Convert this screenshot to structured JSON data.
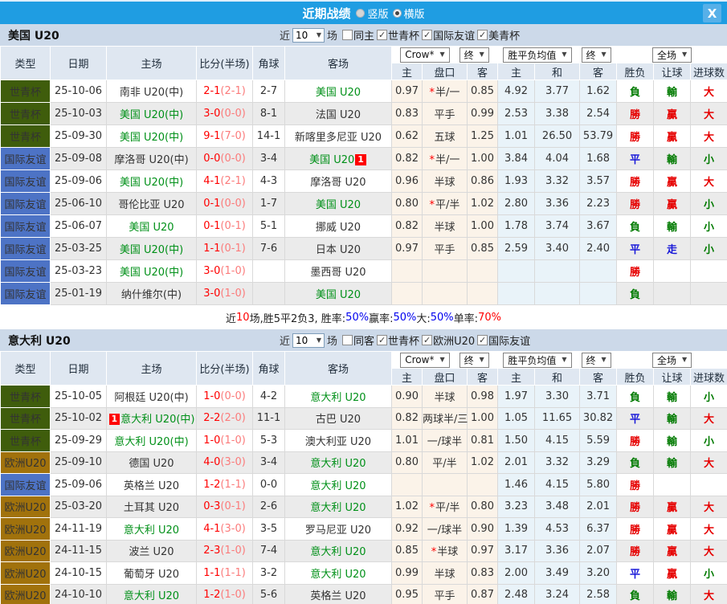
{
  "titlebar": {
    "title": "近期战绩",
    "radios": [
      {
        "label": "竖版",
        "selected": false
      },
      {
        "label": "横版",
        "selected": true
      }
    ],
    "close": "X"
  },
  "glyphs": {
    "check": "✓",
    "arrow": "▼",
    "star": "*"
  },
  "colors": {
    "header_bar": "#1f9de2",
    "section_bar": "#ccd9e9",
    "table_head": "#dfe7f1",
    "row_alt": "#ebebeb",
    "cream": "#fbf3e9",
    "lightblue": "#e9f3f9",
    "team_green": "#009018",
    "score_red": "#ff0000",
    "score_ht": "#fb7b7b"
  },
  "type_styles": {
    "世青杯": "#3f5d0c",
    "国际友谊": "#4d73c5",
    "欧洲U20": "#a1720c"
  },
  "result_colors": {
    "勝": "#e60000",
    "贏": "#e60000",
    "大": "#e60000",
    "負": "#007a00",
    "輸": "#007a00",
    "小": "#007a00",
    "平": "#1818d8",
    "走": "#1818d8"
  },
  "header": {
    "cols": [
      "类型",
      "日期",
      "主场",
      "比分(半场)",
      "角球",
      "客场"
    ],
    "dd1": "Crow*",
    "dd1b": "终",
    "dd2": "胜平负均值",
    "dd2b": "终",
    "dd3": "全场",
    "subcols": [
      "主",
      "盘口",
      "客",
      "主",
      "和",
      "客",
      "胜负",
      "让球",
      "进球数"
    ]
  },
  "sections": [
    {
      "team": "美国 U20",
      "filter": {
        "near": "近",
        "count": "10",
        "unit": "场",
        "checks": [
          {
            "label": "同主",
            "checked": false
          },
          {
            "label": "世青杯",
            "checked": true
          },
          {
            "label": "国际友谊",
            "checked": true
          },
          {
            "label": "美青杯",
            "checked": true
          }
        ]
      },
      "rows": [
        {
          "type": "世青杯",
          "date": "25-10-06",
          "home": "南非 U20(中)",
          "home_green": false,
          "home_badge": "",
          "ft": "2-1",
          "ht": "(2-1)",
          "corners": "2-7",
          "away": "美国 U20",
          "away_green": true,
          "away_badge": "",
          "o1": "0.97",
          "star": true,
          "hcap": "半/一",
          "o2": "0.85",
          "m1": "4.92",
          "m2": "3.77",
          "m3": "1.62",
          "r1": "負",
          "r2": "輸",
          "r3": "大"
        },
        {
          "type": "世青杯",
          "date": "25-10-03",
          "home": "美国 U20(中)",
          "home_green": true,
          "home_badge": "",
          "ft": "3-0",
          "ht": "(0-0)",
          "corners": "8-1",
          "away": "法国 U20",
          "away_green": false,
          "away_badge": "",
          "o1": "0.83",
          "star": false,
          "hcap": "平手",
          "o2": "0.99",
          "m1": "2.53",
          "m2": "3.38",
          "m3": "2.54",
          "r1": "勝",
          "r2": "贏",
          "r3": "大"
        },
        {
          "type": "世青杯",
          "date": "25-09-30",
          "home": "美国 U20(中)",
          "home_green": true,
          "home_badge": "",
          "ft": "9-1",
          "ht": "(7-0)",
          "corners": "14-1",
          "away": "新喀里多尼亚 U20",
          "away_green": false,
          "away_badge": "",
          "o1": "0.62",
          "star": false,
          "hcap": "五球",
          "o2": "1.25",
          "m1": "1.01",
          "m2": "26.50",
          "m3": "53.79",
          "r1": "勝",
          "r2": "贏",
          "r3": "大"
        },
        {
          "type": "国际友谊",
          "date": "25-09-08",
          "home": "摩洛哥 U20(中)",
          "home_green": false,
          "home_badge": "",
          "ft": "0-0",
          "ht": "(0-0)",
          "corners": "3-4",
          "away": "美国 U20",
          "away_green": true,
          "away_badge": "1",
          "o1": "0.82",
          "star": true,
          "hcap": "半/一",
          "o2": "1.00",
          "m1": "3.84",
          "m2": "4.04",
          "m3": "1.68",
          "r1": "平",
          "r2": "輸",
          "r3": "小"
        },
        {
          "type": "国际友谊",
          "date": "25-09-06",
          "home": "美国 U20(中)",
          "home_green": true,
          "home_badge": "",
          "ft": "4-1",
          "ht": "(2-1)",
          "corners": "4-3",
          "away": "摩洛哥 U20",
          "away_green": false,
          "away_badge": "",
          "o1": "0.96",
          "star": false,
          "hcap": "半球",
          "o2": "0.86",
          "m1": "1.93",
          "m2": "3.32",
          "m3": "3.57",
          "r1": "勝",
          "r2": "贏",
          "r3": "大"
        },
        {
          "type": "国际友谊",
          "date": "25-06-10",
          "home": "哥伦比亚 U20",
          "home_green": false,
          "home_badge": "",
          "ft": "0-1",
          "ht": "(0-0)",
          "corners": "1-7",
          "away": "美国 U20",
          "away_green": true,
          "away_badge": "",
          "o1": "0.80",
          "star": true,
          "hcap": "平/半",
          "o2": "1.02",
          "m1": "2.80",
          "m2": "3.36",
          "m3": "2.23",
          "r1": "勝",
          "r2": "贏",
          "r3": "小"
        },
        {
          "type": "国际友谊",
          "date": "25-06-07",
          "home": "美国 U20",
          "home_green": true,
          "home_badge": "",
          "ft": "0-1",
          "ht": "(0-1)",
          "corners": "5-1",
          "away": "挪威 U20",
          "away_green": false,
          "away_badge": "",
          "o1": "0.82",
          "star": false,
          "hcap": "半球",
          "o2": "1.00",
          "m1": "1.78",
          "m2": "3.74",
          "m3": "3.67",
          "r1": "負",
          "r2": "輸",
          "r3": "小"
        },
        {
          "type": "国际友谊",
          "date": "25-03-25",
          "home": "美国 U20(中)",
          "home_green": true,
          "home_badge": "",
          "ft": "1-1",
          "ht": "(0-1)",
          "corners": "7-6",
          "away": "日本 U20",
          "away_green": false,
          "away_badge": "",
          "o1": "0.97",
          "star": false,
          "hcap": "平手",
          "o2": "0.85",
          "m1": "2.59",
          "m2": "3.40",
          "m3": "2.40",
          "r1": "平",
          "r2": "走",
          "r3": "小"
        },
        {
          "type": "国际友谊",
          "date": "25-03-23",
          "home": "美国 U20(中)",
          "home_green": true,
          "home_badge": "",
          "ft": "3-0",
          "ht": "(1-0)",
          "corners": "",
          "away": "墨西哥 U20",
          "away_green": false,
          "away_badge": "",
          "o1": "",
          "star": false,
          "hcap": "",
          "o2": "",
          "m1": "",
          "m2": "",
          "m3": "",
          "r1": "勝",
          "r2": "",
          "r3": ""
        },
        {
          "type": "国际友谊",
          "date": "25-01-19",
          "home": "纳什维尔(中)",
          "home_green": false,
          "home_badge": "",
          "ft": "3-0",
          "ht": "(1-0)",
          "corners": "",
          "away": "美国 U20",
          "away_green": true,
          "away_badge": "",
          "o1": "",
          "star": false,
          "hcap": "",
          "o2": "",
          "m1": "",
          "m2": "",
          "m3": "",
          "r1": "負",
          "r2": "",
          "r3": ""
        }
      ],
      "summary": [
        {
          "text": "近",
          "color": "#222222"
        },
        {
          "text": "10",
          "color": "#ff0000"
        },
        {
          "text": "场,胜5平2负3, 胜率:",
          "color": "#222222"
        },
        {
          "text": "50%",
          "color": "#0000ee"
        },
        {
          "text": " 赢率:",
          "color": "#222222"
        },
        {
          "text": "50%",
          "color": "#0000ee"
        },
        {
          "text": " 大:",
          "color": "#222222"
        },
        {
          "text": "50%",
          "color": "#0000ee"
        },
        {
          "text": " 单率:",
          "color": "#222222"
        },
        {
          "text": "70%",
          "color": "#ff0000"
        }
      ]
    },
    {
      "team": "意大利 U20",
      "filter": {
        "near": "近",
        "count": "10",
        "unit": "场",
        "checks": [
          {
            "label": "同客",
            "checked": false
          },
          {
            "label": "世青杯",
            "checked": true
          },
          {
            "label": "欧洲U20",
            "checked": true
          },
          {
            "label": "国际友谊",
            "checked": true
          }
        ]
      },
      "rows": [
        {
          "type": "世青杯",
          "date": "25-10-05",
          "home": "阿根廷 U20(中)",
          "home_green": false,
          "home_badge": "",
          "ft": "1-0",
          "ht": "(0-0)",
          "corners": "4-2",
          "away": "意大利 U20",
          "away_green": true,
          "away_badge": "",
          "o1": "0.90",
          "star": false,
          "hcap": "半球",
          "o2": "0.98",
          "m1": "1.97",
          "m2": "3.30",
          "m3": "3.71",
          "r1": "負",
          "r2": "輸",
          "r3": "小"
        },
        {
          "type": "世青杯",
          "date": "25-10-02",
          "home": "意大利 U20(中)",
          "home_green": true,
          "home_badge": "1",
          "ft": "2-2",
          "ht": "(2-0)",
          "corners": "11-1",
          "away": "古巴 U20",
          "away_green": false,
          "away_badge": "",
          "o1": "0.82",
          "star": false,
          "hcap": "两球半/三",
          "o2": "1.00",
          "m1": "1.05",
          "m2": "11.65",
          "m3": "30.82",
          "r1": "平",
          "r2": "輸",
          "r3": "大"
        },
        {
          "type": "世青杯",
          "date": "25-09-29",
          "home": "意大利 U20(中)",
          "home_green": true,
          "home_badge": "",
          "ft": "1-0",
          "ht": "(1-0)",
          "corners": "5-3",
          "away": "澳大利亚 U20",
          "away_green": false,
          "away_badge": "",
          "o1": "1.01",
          "star": false,
          "hcap": "一/球半",
          "o2": "0.81",
          "m1": "1.50",
          "m2": "4.15",
          "m3": "5.59",
          "r1": "勝",
          "r2": "輸",
          "r3": "小"
        },
        {
          "type": "欧洲U20",
          "date": "25-09-10",
          "home": "德国 U20",
          "home_green": false,
          "home_badge": "",
          "ft": "4-0",
          "ht": "(3-0)",
          "corners": "3-4",
          "away": "意大利 U20",
          "away_green": true,
          "away_badge": "",
          "o1": "0.80",
          "star": false,
          "hcap": "平/半",
          "o2": "1.02",
          "m1": "2.01",
          "m2": "3.32",
          "m3": "3.29",
          "r1": "負",
          "r2": "輸",
          "r3": "大"
        },
        {
          "type": "国际友谊",
          "date": "25-09-06",
          "home": "英格兰 U20",
          "home_green": false,
          "home_badge": "",
          "ft": "1-2",
          "ht": "(1-1)",
          "corners": "0-0",
          "away": "意大利 U20",
          "away_green": true,
          "away_badge": "",
          "o1": "",
          "star": false,
          "hcap": "",
          "o2": "",
          "m1": "1.46",
          "m2": "4.15",
          "m3": "5.80",
          "r1": "勝",
          "r2": "",
          "r3": ""
        },
        {
          "type": "欧洲U20",
          "date": "25-03-20",
          "home": "土耳其 U20",
          "home_green": false,
          "home_badge": "",
          "ft": "0-3",
          "ht": "(0-1)",
          "corners": "2-6",
          "away": "意大利 U20",
          "away_green": true,
          "away_badge": "",
          "o1": "1.02",
          "star": true,
          "hcap": "平/半",
          "o2": "0.80",
          "m1": "3.23",
          "m2": "3.48",
          "m3": "2.01",
          "r1": "勝",
          "r2": "贏",
          "r3": "大"
        },
        {
          "type": "欧洲U20",
          "date": "24-11-19",
          "home": "意大利 U20",
          "home_green": true,
          "home_badge": "",
          "ft": "4-1",
          "ht": "(3-0)",
          "corners": "3-5",
          "away": "罗马尼亚 U20",
          "away_green": false,
          "away_badge": "",
          "o1": "0.92",
          "star": false,
          "hcap": "一/球半",
          "o2": "0.90",
          "m1": "1.39",
          "m2": "4.53",
          "m3": "6.37",
          "r1": "勝",
          "r2": "贏",
          "r3": "大"
        },
        {
          "type": "欧洲U20",
          "date": "24-11-15",
          "home": "波兰 U20",
          "home_green": false,
          "home_badge": "",
          "ft": "2-3",
          "ht": "(1-0)",
          "corners": "7-4",
          "away": "意大利 U20",
          "away_green": true,
          "away_badge": "",
          "o1": "0.85",
          "star": true,
          "hcap": "半球",
          "o2": "0.97",
          "m1": "3.17",
          "m2": "3.36",
          "m3": "2.07",
          "r1": "勝",
          "r2": "贏",
          "r3": "大"
        },
        {
          "type": "欧洲U20",
          "date": "24-10-15",
          "home": "葡萄牙 U20",
          "home_green": false,
          "home_badge": "",
          "ft": "1-1",
          "ht": "(1-1)",
          "corners": "3-2",
          "away": "意大利 U20",
          "away_green": true,
          "away_badge": "",
          "o1": "0.99",
          "star": false,
          "hcap": "半球",
          "o2": "0.83",
          "m1": "2.00",
          "m2": "3.49",
          "m3": "3.20",
          "r1": "平",
          "r2": "贏",
          "r3": "小"
        },
        {
          "type": "欧洲U20",
          "date": "24-10-10",
          "home": "意大利 U20",
          "home_green": true,
          "home_badge": "",
          "ft": "1-2",
          "ht": "(1-0)",
          "corners": "5-6",
          "away": "英格兰 U20",
          "away_green": false,
          "away_badge": "",
          "o1": "0.95",
          "star": false,
          "hcap": "平手",
          "o2": "0.87",
          "m1": "2.48",
          "m2": "3.24",
          "m3": "2.58",
          "r1": "負",
          "r2": "輸",
          "r3": "大"
        }
      ],
      "summary": null
    }
  ]
}
